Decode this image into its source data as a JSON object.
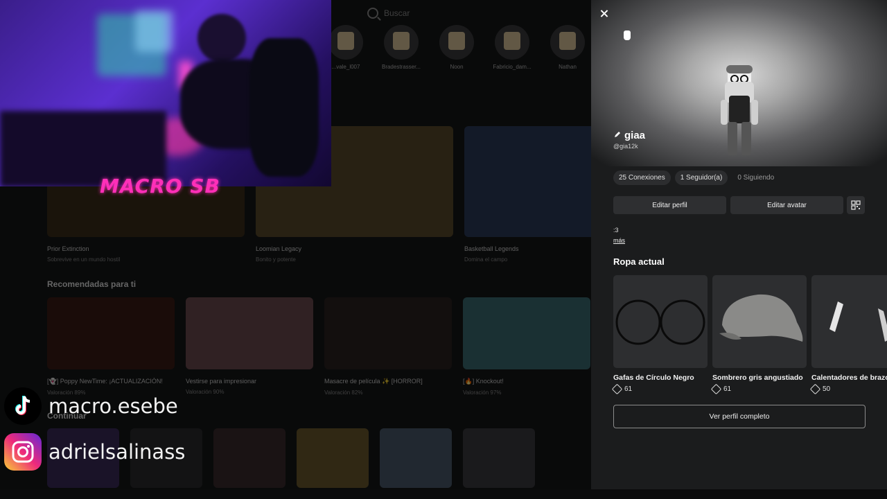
{
  "search": {
    "placeholder": "Buscar"
  },
  "friends": [
    "...vale_l007",
    "Bradestrasser...",
    "Noon",
    "Fabricio_dam...",
    "Nathan"
  ],
  "top_games": [
    {
      "title": "Prior Extinction",
      "subtitle": "Sobrevive en un mundo hostil"
    },
    {
      "title": "Loomian Legacy",
      "subtitle": "Bonito y potente"
    },
    {
      "title": "Basketball Legends",
      "subtitle": "Domina el campo"
    }
  ],
  "recommended": {
    "title": "Recomendadas para ti",
    "games": [
      {
        "title": "[👻] Poppy NewTime: ¡ACTUALIZACIÓN!",
        "rating": "Valoración 89%"
      },
      {
        "title": "Vestirse para impresionar",
        "rating": "Valoración 90%"
      },
      {
        "title": "Masacre de película ✨ [HORROR]",
        "rating": "Valoración 82%"
      },
      {
        "title": "[🔥] Knockout!",
        "rating": "Valoración 97%"
      }
    ]
  },
  "continue_title": "Continuar",
  "stream": {
    "overlay_name": "MACRO SB",
    "tiktok": "macro.esebe",
    "instagram": "adrielsalinass"
  },
  "profile": {
    "display_name": "giaa",
    "username": "@gia12k",
    "connections": "25 Conexiones",
    "followers": "1 Seguidor(a)",
    "following": "0 Siguiendo",
    "edit_profile": "Editar perfil",
    "edit_avatar": "Editar avatar",
    "bio": ":3",
    "more": "más",
    "outfit_title": "Ropa actual",
    "items": [
      {
        "name": "Gafas de Círculo Negro",
        "price": "61"
      },
      {
        "name": "Sombrero gris angustiado",
        "price": "61"
      },
      {
        "name": "Calentadores de brazo",
        "price": "50"
      }
    ],
    "view_full": "Ver perfil completo"
  },
  "colors": {
    "panel": "#1b1c1d",
    "accent_pink": "#ff2fb8"
  }
}
